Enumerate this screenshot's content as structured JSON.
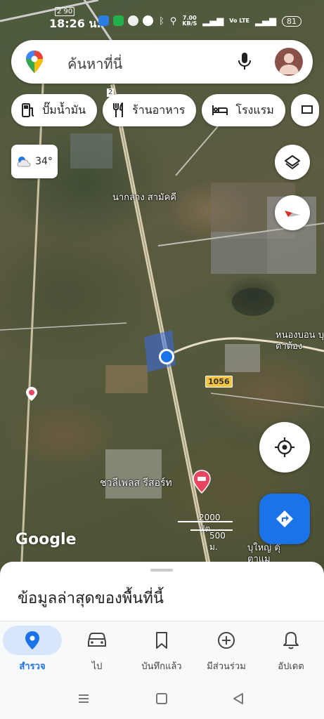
{
  "status_bar": {
    "carrier": "2 90",
    "time": "18:26 น.",
    "speed_value": "7.00",
    "speed_unit": "KB/S",
    "network": "Vo LTE",
    "battery": "81"
  },
  "search": {
    "placeholder": "ค้นหาที่นี่"
  },
  "chips": [
    {
      "label": "ปั๊มน้ำมัน",
      "icon": "gas-station-icon"
    },
    {
      "label": "ร้านอาหาร",
      "icon": "restaurant-icon"
    },
    {
      "label": "โรงแรม",
      "icon": "hotel-icon"
    }
  ],
  "weather": {
    "temperature": "34°",
    "icon": "partly-cloudy-icon"
  },
  "map": {
    "labels": {
      "area1": "นากลาง สามัคคี",
      "area2": "หนองบอน บุตาต้อง",
      "resort": "ชวลีเพลส รีสอร์ท",
      "area3": "บุใหญ่ ตุ๊ตาแม"
    },
    "route_number": "1056",
    "road_number": "2",
    "scale": {
      "feet": "2000 ฟุต",
      "meters": "500 ม."
    },
    "logo": "Google"
  },
  "sheet": {
    "title": "ข้อมูลล่าสุดของพื้นที่นี้"
  },
  "bottom_nav": [
    {
      "label": "สำรวจ",
      "icon": "explore-pin-icon",
      "active": true
    },
    {
      "label": "ไป",
      "icon": "car-icon",
      "active": false
    },
    {
      "label": "บันทึกแล้ว",
      "icon": "bookmark-icon",
      "active": false
    },
    {
      "label": "มีส่วนร่วม",
      "icon": "add-circle-icon",
      "active": false
    },
    {
      "label": "อัปเดต",
      "icon": "bell-icon",
      "active": false
    }
  ],
  "colors": {
    "accent": "#1a73e8",
    "active_pill": "#d8e6fb",
    "resort_pin": "#e94560",
    "route_shield": "#f4c542"
  }
}
